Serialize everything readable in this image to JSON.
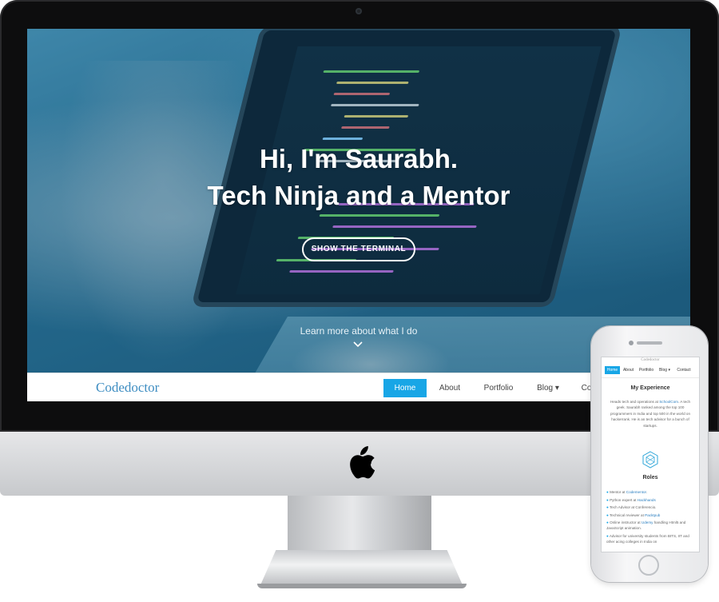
{
  "hero": {
    "title_line1": "Hi, I'm Saurabh.",
    "title_line2": "Tech Ninja and a Mentor",
    "cta_label": "SHOW THE TERMINAL",
    "learn_more": "Learn more about what I do"
  },
  "navbar": {
    "brand": "Codedoctor",
    "items": [
      {
        "label": "Home",
        "active": true
      },
      {
        "label": "About"
      },
      {
        "label": "Portfolio"
      },
      {
        "label": "Blog ▾"
      },
      {
        "label": "Co"
      }
    ]
  },
  "mobile": {
    "brand": "Codedoctor",
    "nav": [
      {
        "label": "Home",
        "active": true
      },
      {
        "label": "About"
      },
      {
        "label": "Portfolio"
      },
      {
        "label": "Blog ▾"
      },
      {
        "label": "Contact"
      }
    ],
    "experience_heading": "My Experience",
    "experience_text_1": "Heads tech and operations at ",
    "experience_link": "SchoolCom",
    "experience_text_2": ". A tech geek. Saurabh ranked among the top 100 programmers in India and top 500 in the world on hackerrank. He is an tech advisor for a bunch of startups.",
    "roles_heading": "Roles",
    "roles": [
      {
        "prefix": "Mentor at ",
        "link": "Codementor",
        "suffix": "."
      },
      {
        "prefix": "Python expert at ",
        "link": "Hackhands",
        "suffix": ""
      },
      {
        "prefix": "Tech Advisor at Conferencio.",
        "link": "",
        "suffix": ""
      },
      {
        "prefix": "Technical reviewer at ",
        "link": "Packtpub",
        "suffix": ""
      },
      {
        "prefix": "Online instructor at ",
        "link": "Udemy",
        "suffix": " handling Html5 and JavaScript animation."
      },
      {
        "prefix": "Advisor for university students from BITS, IIT and other acing colleges in India on",
        "link": "",
        "suffix": ""
      }
    ]
  },
  "colors": {
    "accent": "#18a6e6",
    "brand": "#3f8ec2",
    "hero_tint": "#2a6f91"
  }
}
